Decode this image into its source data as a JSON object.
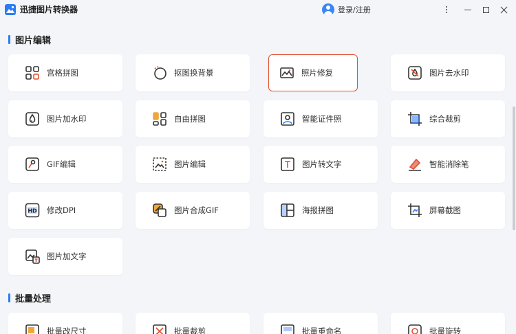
{
  "app": {
    "title": "迅捷图片转换器"
  },
  "header": {
    "login_label": "登录/注册"
  },
  "sections": [
    {
      "title": "图片编辑"
    },
    {
      "title": "批量处理"
    }
  ],
  "tools": [
    {
      "label": "宫格拼图",
      "icon": "grid-icon"
    },
    {
      "label": "抠图换背景",
      "icon": "cutout-icon"
    },
    {
      "label": "照片修复",
      "icon": "photo-restore-icon"
    },
    {
      "label": "图片去水印",
      "icon": "remove-watermark-icon"
    },
    {
      "label": "图片加水印",
      "icon": "add-watermark-icon"
    },
    {
      "label": "自由拼图",
      "icon": "free-collage-icon"
    },
    {
      "label": "智能证件照",
      "icon": "id-photo-icon"
    },
    {
      "label": "综合裁剪",
      "icon": "crop-icon"
    },
    {
      "label": "GIF编辑",
      "icon": "gif-edit-icon"
    },
    {
      "label": "图片编辑",
      "icon": "image-edit-icon"
    },
    {
      "label": "图片转文字",
      "icon": "image-to-text-icon"
    },
    {
      "label": "智能消除笔",
      "icon": "eraser-pen-icon"
    },
    {
      "label": "修改DPI",
      "icon": "hd-icon"
    },
    {
      "label": "图片合成GIF",
      "icon": "gif-compose-icon"
    },
    {
      "label": "海报拼图",
      "icon": "poster-collage-icon"
    },
    {
      "label": "屏幕截图",
      "icon": "screenshot-icon"
    },
    {
      "label": "图片加文字",
      "icon": "add-text-icon"
    }
  ],
  "batch_tools": [
    {
      "label": "批量改尺寸",
      "icon": "batch-resize-icon"
    },
    {
      "label": "批量裁剪",
      "icon": "batch-crop-icon"
    },
    {
      "label": "批量重命名",
      "icon": "batch-rename-icon"
    },
    {
      "label": "批量旋转",
      "icon": "batch-rotate-icon"
    }
  ],
  "colors": {
    "accent": "#2f7bf5",
    "selected_border": "#e0522f",
    "background": "#f3f5f9"
  },
  "selected_tool": "照片修复"
}
